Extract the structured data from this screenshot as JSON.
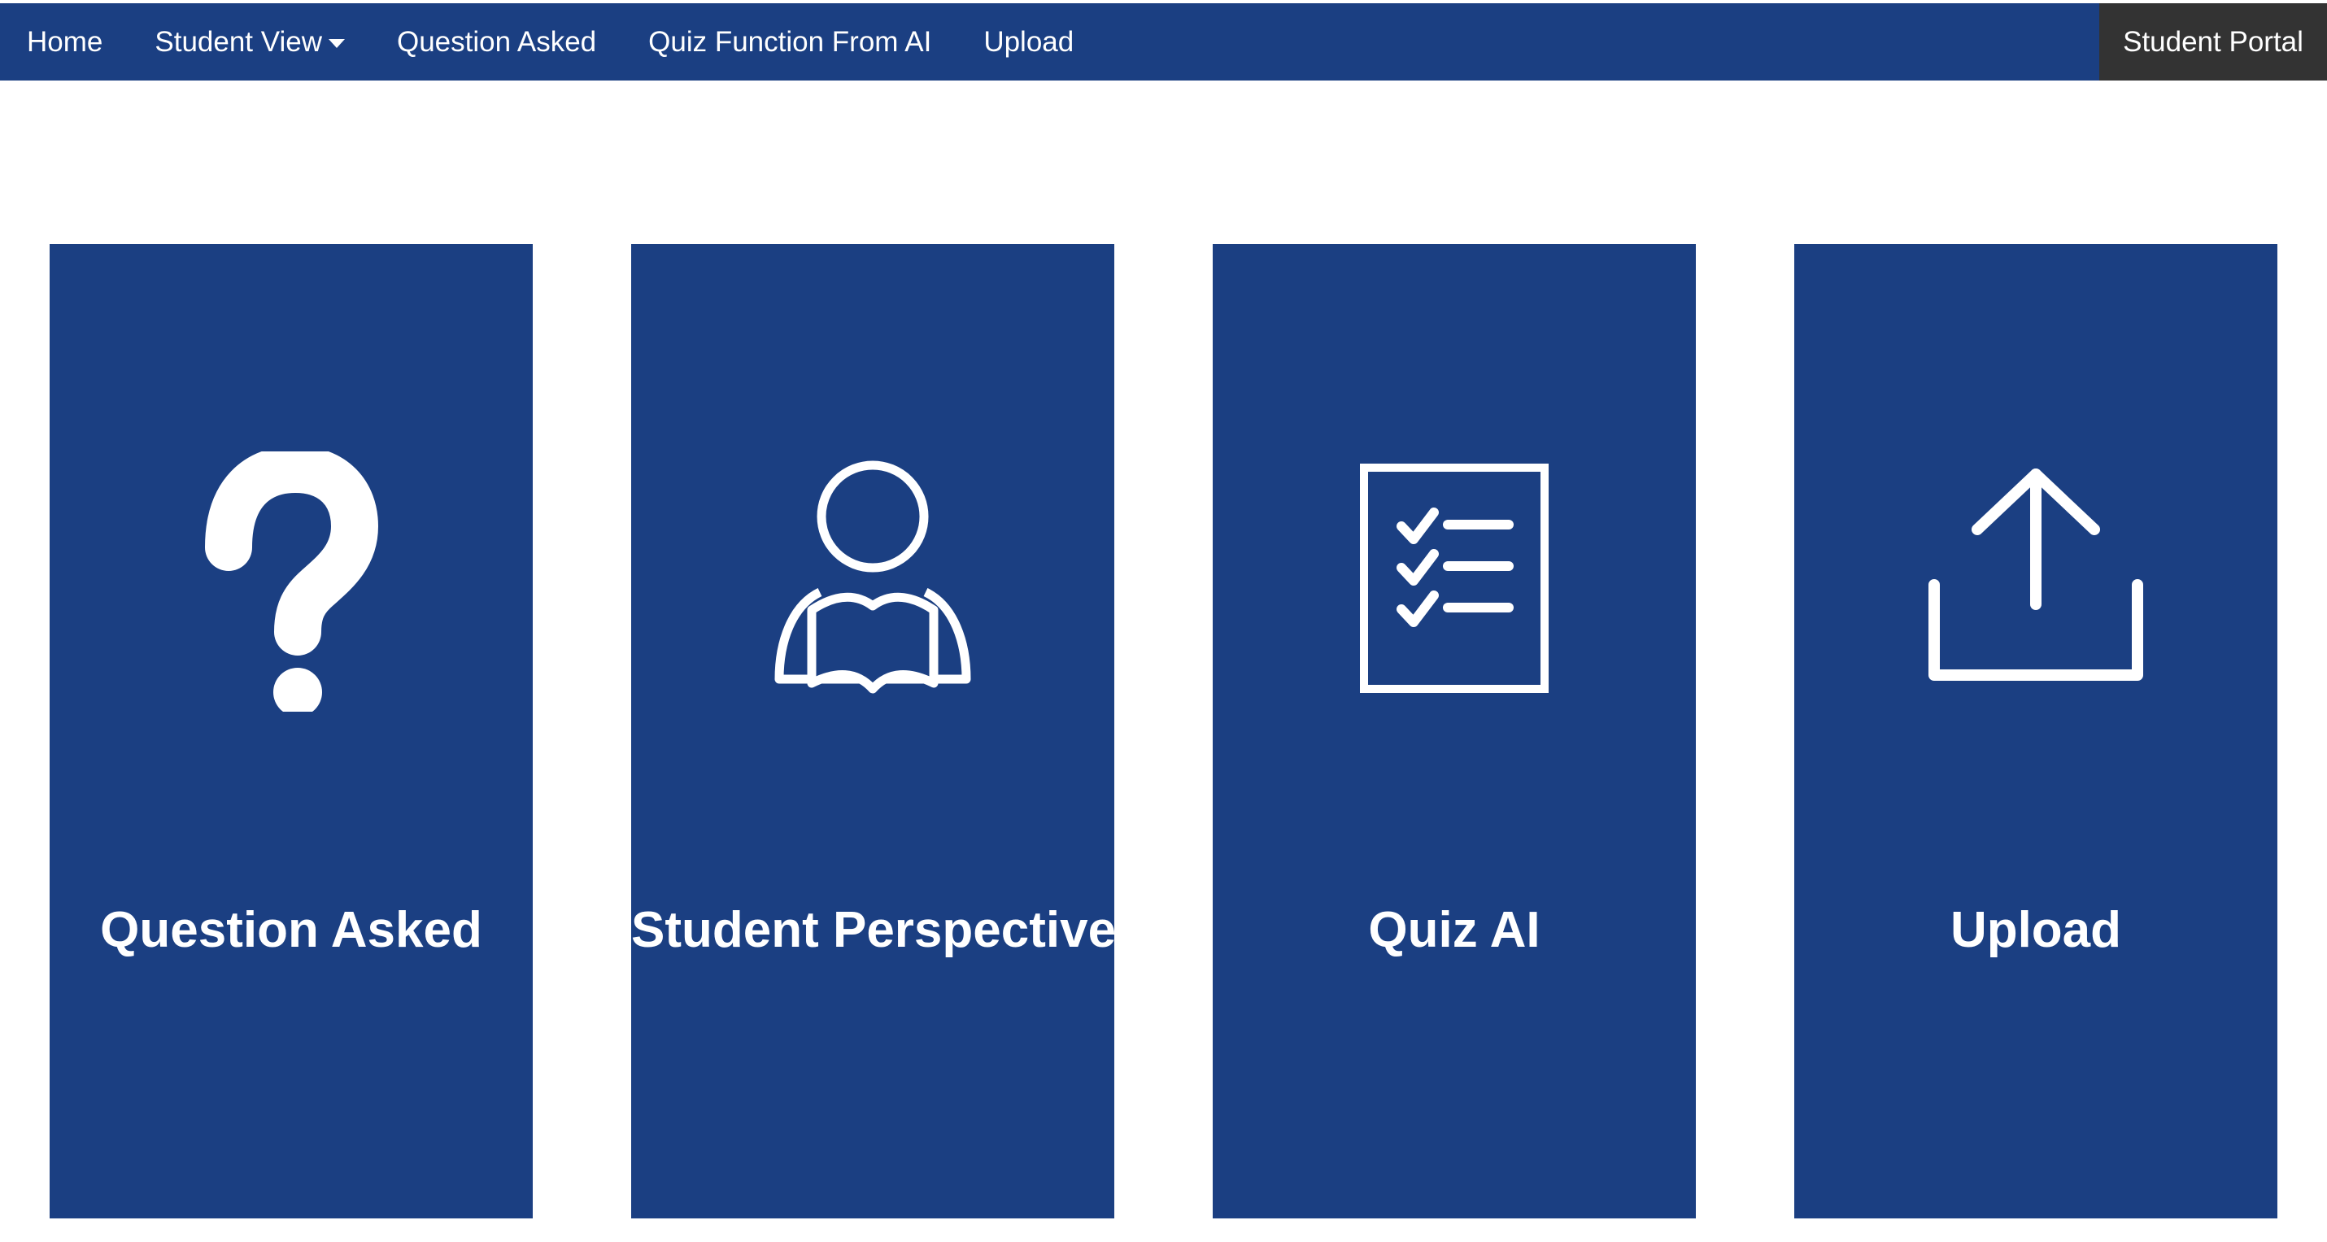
{
  "colors": {
    "nav_background": "#1b3f82",
    "portal_background": "#333333",
    "card_background": "#1b3f82",
    "text": "#ffffff"
  },
  "nav": {
    "home": "Home",
    "student_view": "Student View",
    "question_asked": "Question Asked",
    "quiz_function": "Quiz Function From AI",
    "upload": "Upload",
    "portal": "Student Portal"
  },
  "cards": [
    {
      "title": "Question Asked",
      "icon": "question-mark-icon"
    },
    {
      "title": "Student Perspective",
      "icon": "student-reading-icon"
    },
    {
      "title": "Quiz AI",
      "icon": "checklist-icon"
    },
    {
      "title": "Upload",
      "icon": "upload-icon"
    }
  ]
}
